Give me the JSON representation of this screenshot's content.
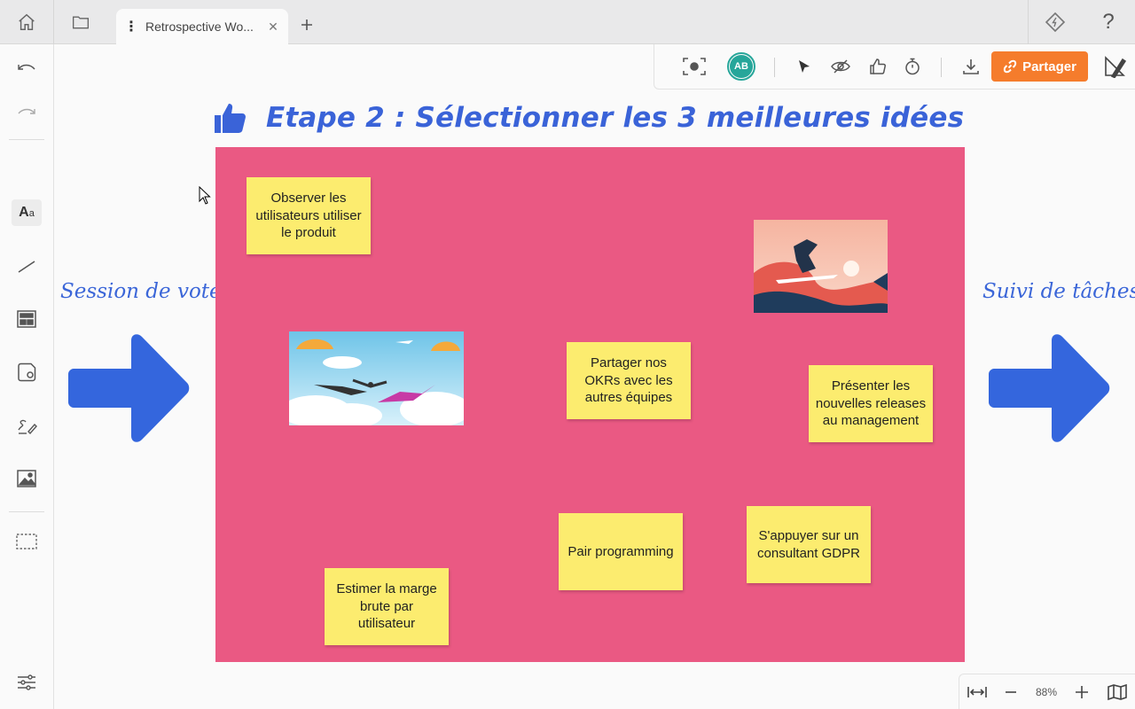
{
  "tab": {
    "title": "Retrospective Wo...",
    "menu_icon": "more-vertical-icon",
    "close_icon": "close-icon"
  },
  "topbar": {
    "home_icon": "home-icon",
    "folder_icon": "folder-icon",
    "new_tab_icon": "plus-icon",
    "integration_icon": "diamond-logo-icon",
    "help_label": "?"
  },
  "sidebar": {
    "items": [
      "undo-icon",
      "redo-icon",
      "text-tool-icon",
      "line-tool-icon",
      "template-icon",
      "sticky-note-icon",
      "pen-tool-icon",
      "image-icon",
      "frame-select-icon",
      "settings-sliders-icon"
    ]
  },
  "toolbar": {
    "avatar_initials": "AB",
    "avatar_color": "#26a69a",
    "share_label": "Partager",
    "share_color": "#f57c2c",
    "icons": [
      "screen-capture-icon",
      "pointer-icon",
      "hide-eye-icon",
      "vote-thumb-icon",
      "timer-icon",
      "download-icon",
      "pen-ruler-icon"
    ]
  },
  "canvas": {
    "heading": "Etape 2 : Sélectionner les 3 meilleures idées",
    "heading_color": "#3a63d8",
    "board_color": "#ea5983",
    "sticky_color": "#fcec6f",
    "left_label": "Session de vote",
    "right_label": "Suivi de tâches",
    "stickies": [
      [
        "Observer les",
        "utilisateurs utiliser",
        "le produit"
      ],
      [
        "Partager nos",
        "OKRs avec les",
        "autres équipes"
      ],
      [
        "Présenter les",
        "nouvelles releases",
        "au management"
      ],
      [
        "Pair programming"
      ],
      [
        "S'appuyer sur un",
        "consultant GDPR"
      ],
      [
        "Estimer la marge",
        "brute par",
        "utilisateur"
      ]
    ]
  },
  "zoom": {
    "value": "88%",
    "icons": [
      "fit-width-icon",
      "zoom-out-icon",
      "zoom-in-icon",
      "map-icon"
    ]
  }
}
